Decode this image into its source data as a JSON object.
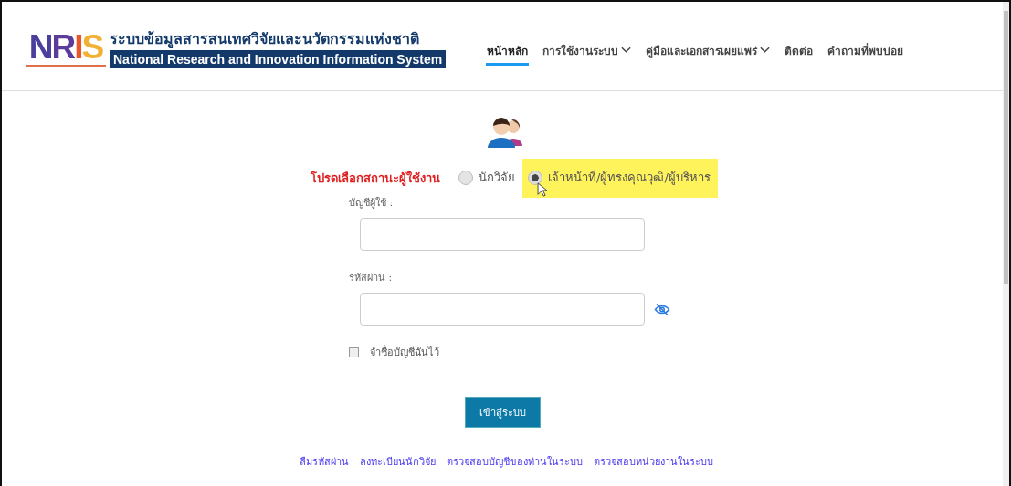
{
  "logo": {
    "mark": "NRIS",
    "title_th": "ระบบข้อมูลสารสนเทศวิจัยและนวัตกรรมแห่งชาติ",
    "title_en": "National Research and Innovation Information System"
  },
  "nav": [
    {
      "label": "หน้าหลัก",
      "selected": true,
      "dropdown": false
    },
    {
      "label": "การใช้งานระบบ",
      "selected": false,
      "dropdown": true
    },
    {
      "label": "คู่มือและเอกสารเผยแพร่",
      "selected": false,
      "dropdown": true
    },
    {
      "label": "ติดต่อ",
      "selected": false,
      "dropdown": false
    },
    {
      "label": "คำถามที่พบบ่อย",
      "selected": false,
      "dropdown": false
    }
  ],
  "login": {
    "role_prompt": "โปรดเลือกสถานะผู้ใช้งาน",
    "roles": [
      {
        "label": "นักวิจัย",
        "selected": false,
        "highlighted": false
      },
      {
        "label": "เจ้าหน้าที่/ผู้ทรงคุณวุฒิ/ผู้บริหาร",
        "selected": true,
        "highlighted": true
      }
    ],
    "username_label": "บัญชีผู้ใช้ :",
    "password_label": "รหัสผ่าน :",
    "remember": {
      "label": "จำชื่อบัญชีฉันไว้",
      "checked": false
    },
    "submit": "เข้าสู่ระบบ",
    "links": [
      "ลืมรหัสผ่าน",
      "ลงทะเบียนนักวิจัย",
      "ตรวจสอบบัญชีของท่านในระบบ",
      "ตรวจสอบหน่วยงานในระบบ"
    ]
  }
}
